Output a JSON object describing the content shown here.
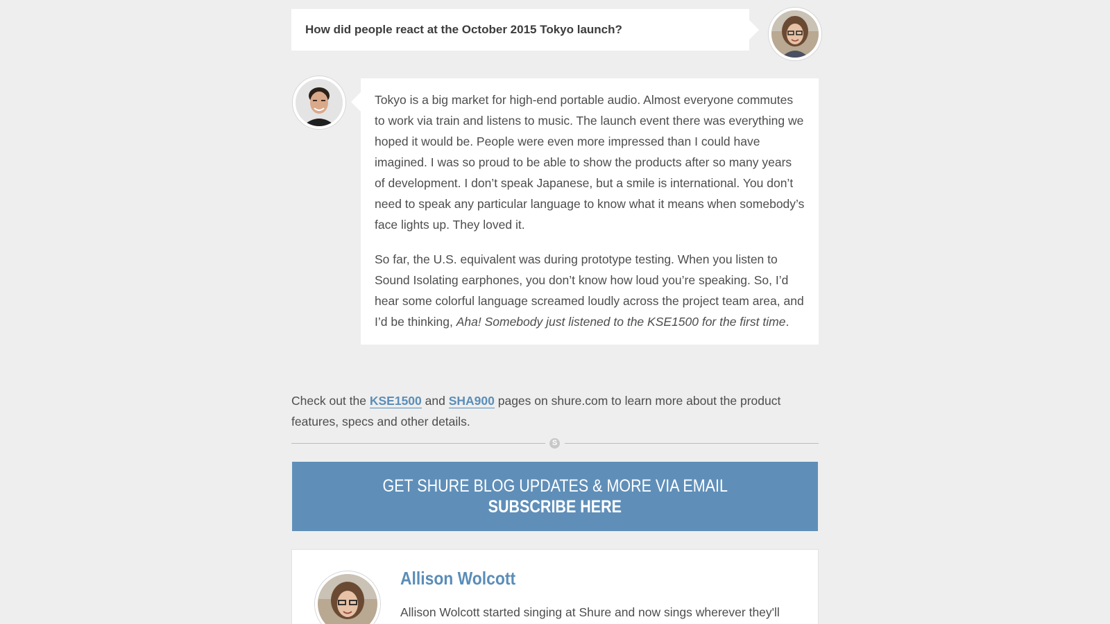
{
  "question": {
    "text": "How did people react at the October 2015 Tokyo launch?"
  },
  "answer": {
    "paragraph1": "Tokyo is a big market for high-end portable audio. Almost everyone commutes to work via train and listens to music. The launch event there was everything we hoped it would be. People were even more impressed than I could have imagined. I was so proud to be able to show the products after so many years of development. I don’t speak Japanese, but a smile is international. You don’t need to speak any particular language to know what it means when somebody’s face lights up. They loved it.",
    "paragraph2_start": "So far, the U.S. equivalent was during prototype testing. When you listen to Sound Isolating earphones, you don’t know how loud you’re speaking. So, I’d hear some colorful language screamed loudly across the project team area, and I’d be thinking, ",
    "paragraph2_italic": "Aha! Somebody just listened to the KSE1500 for the first time",
    "paragraph2_end": "."
  },
  "closing": {
    "before": "Check out the ",
    "link1": "KSE1500",
    "middle": " and ",
    "link2": "SHA900",
    "after": " pages on shure.com to learn more about the product features, specs and other details."
  },
  "divider": {
    "mark": "S"
  },
  "subscribe": {
    "line1": "GET SHURE BLOG UPDATES & MORE VIA EMAIL",
    "line2": "SUBSCRIBE HERE",
    "background": "#5f8fb9"
  },
  "author": {
    "name": "Allison Wolcott",
    "bio": "Allison Wolcott started singing at Shure and now sings wherever they'll"
  },
  "colors": {
    "link": "#5b8db8",
    "page_background": "#eeeeee"
  }
}
